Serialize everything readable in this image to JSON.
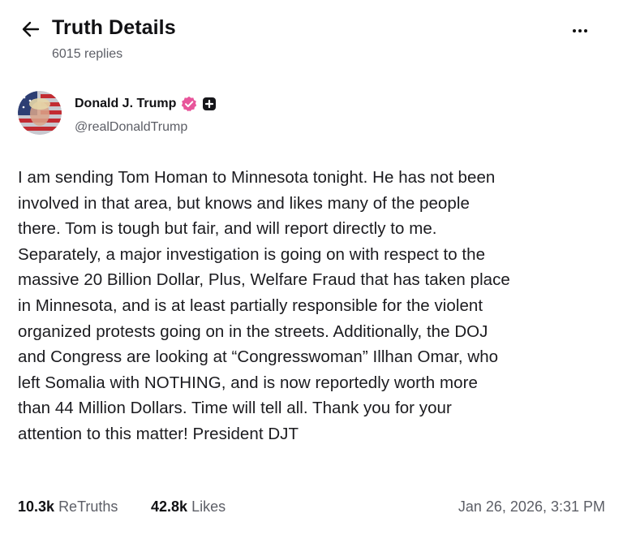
{
  "header": {
    "title": "Truth Details",
    "replies": "6015 replies"
  },
  "author": {
    "name": "Donald J. Trump",
    "handle": "@realDonaldTrump"
  },
  "post": {
    "text": "I am sending Tom Homan to Minnesota tonight. He has not been\ninvolved in that area, but knows and likes many of the people\nthere. Tom is tough but fair, and will report directly to me.\nSeparately, a major investigation is going on with respect to the\nmassive 20 Billion Dollar, Plus, Welfare Fraud that has taken place\nin Minnesota, and is at least partially responsible for the violent\norganized protests going on in the streets. Additionally, the DOJ\nand Congress are looking at “Congresswoman” Illhan Omar, who\nleft Somalia with NOTHING, and is now reportedly worth more\nthan 44 Million Dollars. Time will tell all. Thank you for your\nattention to this matter! President DJT"
  },
  "stats": {
    "retruths_count": "10.3k",
    "retruths_label": "ReTruths",
    "likes_count": "42.8k",
    "likes_label": "Likes",
    "timestamp": "Jan 26, 2026, 3:31 PM"
  },
  "icons": {
    "back": "arrow-left-icon",
    "more": "more-horizontal-icon",
    "verified": "verified-badge-icon",
    "plus": "plus-badge-icon"
  },
  "colors": {
    "verified_badge": "#e8559b",
    "muted_text": "#5c5e66"
  }
}
